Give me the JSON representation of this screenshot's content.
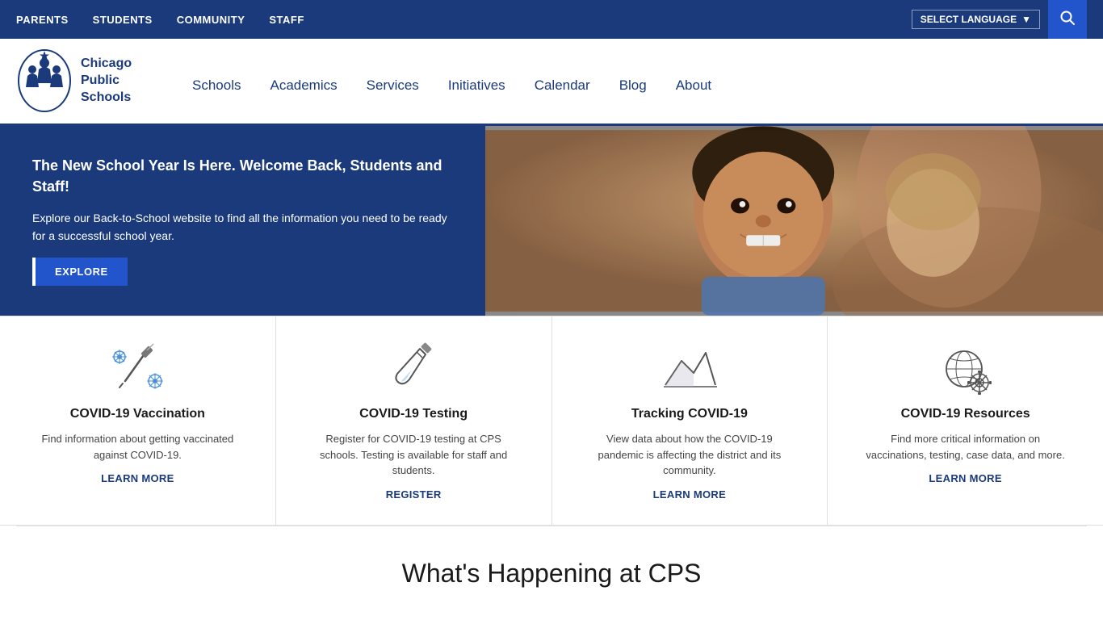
{
  "topBar": {
    "navItems": [
      {
        "label": "PARENTS",
        "name": "parents"
      },
      {
        "label": "STUDENTS",
        "name": "students"
      },
      {
        "label": "COMMUNITY",
        "name": "community"
      },
      {
        "label": "STAFF",
        "name": "staff"
      }
    ],
    "langSelect": "SELECT LANGUAGE",
    "langArrow": "▼"
  },
  "header": {
    "logoLine1": "Chicago",
    "logoLine2": "Public",
    "logoLine3": "Schools",
    "mainNav": [
      {
        "label": "Schools"
      },
      {
        "label": "Academics"
      },
      {
        "label": "Services"
      },
      {
        "label": "Initiatives"
      },
      {
        "label": "Calendar"
      },
      {
        "label": "Blog"
      },
      {
        "label": "About"
      }
    ]
  },
  "hero": {
    "headline": "The New School Year Is Here. Welcome Back, Students and Staff!",
    "body": "Explore our Back-to-School website to find all the information you need to be ready for a successful school year.",
    "buttonLabel": "EXPLORE"
  },
  "cards": [
    {
      "id": "vaccination",
      "title": "COVID-19 Vaccination",
      "description": "Find information about getting vaccinated against COVID-19.",
      "linkLabel": "LEARN MORE"
    },
    {
      "id": "testing",
      "title": "COVID-19 Testing",
      "description": "Register for COVID-19 testing at CPS schools. Testing is available for staff and students.",
      "linkLabel": "REGISTER"
    },
    {
      "id": "tracking",
      "title": "Tracking COVID-19",
      "description": "View data about how the COVID-19 pandemic is affecting the district and its community.",
      "linkLabel": "LEARN MORE"
    },
    {
      "id": "resources",
      "title": "COVID-19 Resources",
      "description": "Find more critical information on vaccinations, testing, case data, and more.",
      "linkLabel": "LEARN MORE"
    }
  ],
  "bottomSection": {
    "heading": "What's Happening at CPS"
  }
}
